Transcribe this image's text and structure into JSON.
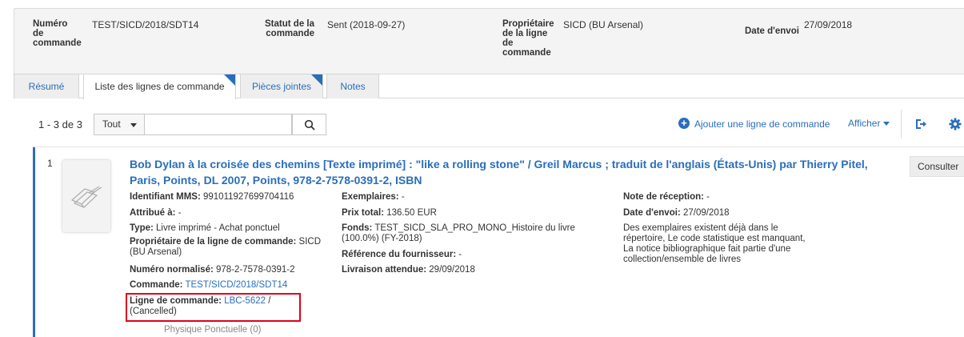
{
  "summary": {
    "numero_label": "Numéro de commande",
    "numero_value": "TEST/SICD/2018/SDT14",
    "statut_label": "Statut de la commande",
    "statut_value": "Sent (2018-09-27)",
    "proprietaire_label": "Propriétaire de la ligne de commande",
    "proprietaire_value": "SICD (BU Arsenal)",
    "date_label": "Date d'envoi",
    "date_value": "27/09/2018"
  },
  "tabs": [
    {
      "label": "Résumé"
    },
    {
      "label": "Liste des lignes de commande"
    },
    {
      "label": "Pièces jointes"
    },
    {
      "label": "Notes"
    }
  ],
  "toolbar": {
    "count": "1 - 3 de 3",
    "filter_value": "Tout",
    "search_value": "",
    "add_line_label": "Ajouter une ligne de commande",
    "afficher_label": "Afficher"
  },
  "record": {
    "number": "1",
    "title": "Bob Dylan à la croisée des chemins [Texte imprimé] : \"like a rolling stone\" / Greil Marcus ; traduit de l'anglais (États-Unis) par Thierry Pitel, Paris, Points, DL 2007, Points, 978-2-7578-0391-2, ISBN",
    "consulter_label": "Consulter",
    "col1": {
      "mms_label": "Identifiant MMS:",
      "mms_value": "991011927699704116",
      "attribue_label": "Attribué à:",
      "attribue_value": "-",
      "type_label": "Type:",
      "type_value": "Livre imprimé - Achat ponctuel",
      "prop_label": "Propriétaire de la ligne de commande:",
      "prop_value_1": "SICD",
      "prop_value_2": "(BU Arsenal)",
      "isbn_label": "Numéro normalisé:",
      "isbn_value": "978-2-7578-0391-2",
      "commande_label": "Commande:",
      "commande_value": "TEST/SICD/2018/SDT14",
      "ligne_label": "Ligne de commande:",
      "ligne_link": "LBC-5622",
      "ligne_suffix": "/",
      "ligne_status": "(Cancelled)"
    },
    "col2": {
      "exemplaires_label": "Exemplaires:",
      "exemplaires_value": "-",
      "prix_label": "Prix total:",
      "prix_value": "136.50 EUR",
      "fonds_label": "Fonds:",
      "fonds_value_1": "TEST_SICD_SLA_PRO_MONO_Histoire du livre",
      "fonds_value_2": "(100.0%) (FY-2018)",
      "ref_label": "Référence du fournisseur:",
      "ref_value": "-",
      "livraison_label": "Livraison attendue:",
      "livraison_value": "29/09/2018"
    },
    "col3": {
      "note_label": "Note de réception:",
      "note_value": "-",
      "envoi_label": "Date d'envoi:",
      "envoi_value": "27/09/2018",
      "msg_1": "Des exemplaires existent déjà dans le",
      "msg_2": "répertoire, Le code statistique est manquant,",
      "msg_3": "La notice bibliographique fait partie d'une",
      "msg_4": "collection/ensemble de livres"
    },
    "physique": "Physique Ponctuelle (0)"
  },
  "colors": {
    "accent": "#2a6ebb",
    "highlight": "#e0001b"
  },
  "icons": {
    "search": "search-icon",
    "add": "plus-circle-icon",
    "export": "export-icon",
    "settings": "gear-icon",
    "book": "book-placeholder-icon"
  }
}
